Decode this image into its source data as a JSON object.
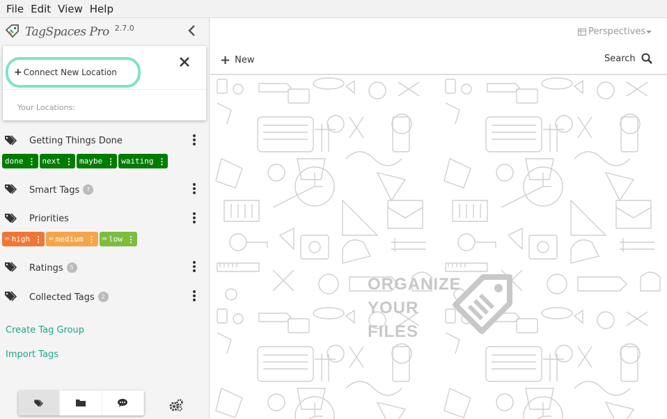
{
  "menu": [
    "File",
    "Edit",
    "View",
    "Help"
  ],
  "brand": {
    "name": "TagSpaces Pro",
    "version": "2.7.0"
  },
  "popover": {
    "connect_label": "Connect New Location",
    "your_locations": "Your Locations:"
  },
  "tag_groups": [
    {
      "title": "Getting Things Done",
      "count": "",
      "tags": [
        {
          "label": "done",
          "color": "#007c00"
        },
        {
          "label": "next",
          "color": "#007c00"
        },
        {
          "label": "maybe",
          "color": "#007c00"
        },
        {
          "label": "waiting",
          "color": "#007c00"
        }
      ]
    },
    {
      "title": "Smart Tags",
      "count": "7",
      "tags": []
    },
    {
      "title": "Priorities",
      "count": "",
      "tags": [
        {
          "label": "high",
          "color": "#ef7735"
        },
        {
          "label": "medium",
          "color": "#f4a54b"
        },
        {
          "label": "low",
          "color": "#7cbd3e"
        }
      ]
    },
    {
      "title": "Ratings",
      "count": "5",
      "tags": []
    },
    {
      "title": "Collected Tags",
      "count": "2",
      "tags": []
    }
  ],
  "links": {
    "create_tag_group": "Create Tag Group",
    "import_tags": "Import Tags"
  },
  "right": {
    "perspectives": "Perspectives",
    "new_label": "New",
    "search_label": "Search",
    "watermark": [
      "ORGANIZE",
      "YOUR",
      "FILES"
    ]
  },
  "colors": {
    "accent": "#20a58a",
    "highlight": "#7ee3c8",
    "gtd": "#007c00"
  }
}
